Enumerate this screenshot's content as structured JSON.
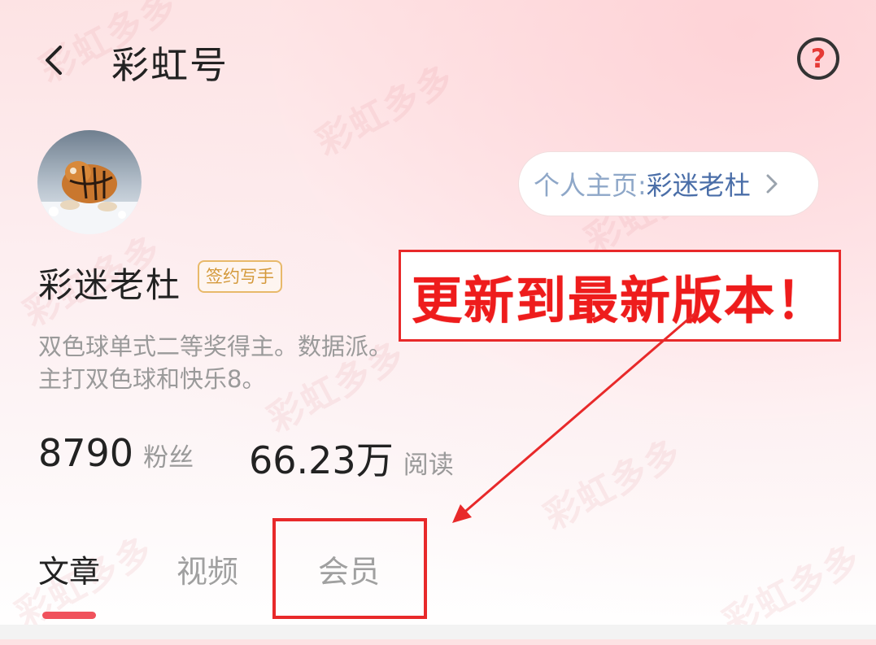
{
  "header": {
    "title": "彩虹号",
    "back_icon": "chevron-left-icon",
    "help_icon": "question-circle-icon",
    "help_glyph": "?"
  },
  "profile": {
    "avatar_icon": "tiger-avatar",
    "homepage_prefix": "个人主页:",
    "homepage_name": "彩迷老杜",
    "homepage_chevron_icon": "chevron-right-icon",
    "name": "彩迷老杜",
    "badge": "签约写手",
    "bio_lines": [
      "双色球单式二等奖得主。数据派。",
      "主打双色球和快乐8。"
    ]
  },
  "stats": [
    {
      "value": "8790",
      "label": "粉丝"
    },
    {
      "value": "66.23万",
      "label": "阅读"
    }
  ],
  "tabs": [
    {
      "label": "文章",
      "active": true
    },
    {
      "label": "视频",
      "active": false
    },
    {
      "label": "会员",
      "active": false
    }
  ],
  "annotation": {
    "text": "更新到最新版本！",
    "color": "#ee1c1c"
  },
  "watermark": "彩虹多多",
  "colors": {
    "accent": "#f0525c",
    "annotation_red": "#e8292a",
    "link_blue": "#4a6ea8",
    "badge_gold": "#d49a3c"
  }
}
